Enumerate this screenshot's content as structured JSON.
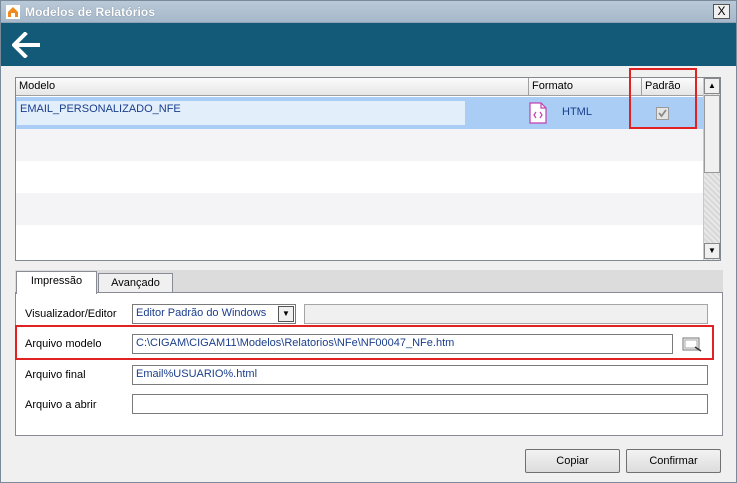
{
  "window": {
    "title": "Modelos de Relatórios",
    "close_label": "X"
  },
  "toolbar": {
    "back_icon": "arrow-left-icon",
    "bg_color": "#125a78"
  },
  "grid": {
    "columns": [
      "Modelo",
      "Formato",
      "Padrão"
    ],
    "rows": [
      {
        "modelo": "EMAIL_PERSONALIZADO_NFE",
        "formato": "HTML",
        "padrao": true
      }
    ]
  },
  "tabs": [
    {
      "label": "Impressão",
      "active": true
    },
    {
      "label": "Avançado",
      "active": false
    }
  ],
  "form": {
    "visualizador_label": "Visualizador/Editor",
    "visualizador_value": "Editor Padrão do Windows",
    "arquivo_modelo_label": "Arquivo modelo",
    "arquivo_modelo_value": "C:\\CIGAM\\CIGAM11\\Modelos\\Relatorios\\NFe\\NF00047_NFe.htm",
    "arquivo_final_label": "Arquivo final",
    "arquivo_final_value": "Email%USUARIO%.html",
    "arquivo_abrir_label": "Arquivo a abrir",
    "arquivo_abrir_value": ""
  },
  "buttons": {
    "copiar": "Copiar",
    "confirmar": "Confirmar"
  },
  "highlight_color": "#e02222"
}
